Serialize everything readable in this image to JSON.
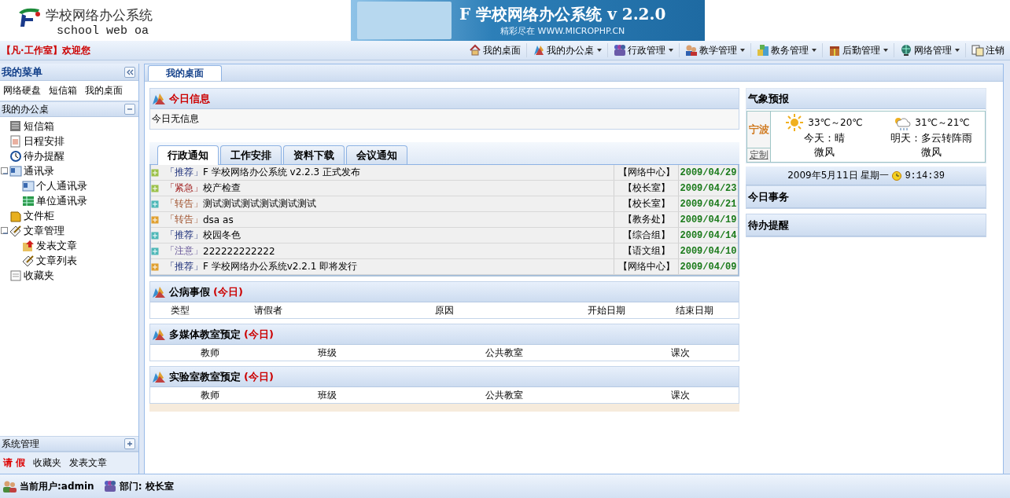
{
  "header": {
    "logo_title": "学校网络办公系统",
    "logo_subtitle": "school web oa",
    "banner": {
      "title": "F 学校网络办公系统 v 2.2.0",
      "subtitle": "精彩尽在 WWW.MICROPHP.CN"
    }
  },
  "welcome": "【凡·工作室】欢迎您",
  "nav": [
    {
      "label": "我的桌面",
      "has_menu": false
    },
    {
      "label": "我的办公桌",
      "has_menu": true
    },
    {
      "label": "行政管理",
      "has_menu": true
    },
    {
      "label": "教学管理",
      "has_menu": true
    },
    {
      "label": "教务管理",
      "has_menu": true
    },
    {
      "label": "后勤管理",
      "has_menu": true
    },
    {
      "label": "网络管理",
      "has_menu": true
    },
    {
      "label": "注销",
      "has_menu": false
    }
  ],
  "sidebar": {
    "title": "我的菜单",
    "quick_links": [
      "网络硬盘",
      "短信箱",
      "我的桌面"
    ],
    "desk": {
      "title": "我的办公桌",
      "expanded": true,
      "tree": [
        {
          "label": "短信箱"
        },
        {
          "label": "日程安排"
        },
        {
          "label": "待办提醒"
        },
        {
          "label": "通讯录",
          "expanded": true,
          "children": [
            {
              "label": "个人通讯录"
            },
            {
              "label": "单位通讯录"
            }
          ]
        },
        {
          "label": "文件柜"
        },
        {
          "label": "文章管理",
          "expanded": true,
          "children": [
            {
              "label": "发表文章"
            },
            {
              "label": "文章列表"
            }
          ]
        },
        {
          "label": "收藏夹"
        }
      ]
    },
    "system": {
      "title": "系统管理",
      "expanded": false
    },
    "bottom_links": [
      {
        "label": "请 假",
        "kind": "highlight"
      },
      {
        "label": "收藏夹",
        "kind": "plain"
      },
      {
        "label": "发表文章",
        "kind": "plain"
      }
    ]
  },
  "main_tabs": [
    {
      "label": "我的桌面",
      "selected": true
    }
  ],
  "today_info": {
    "title": "今日信息",
    "text": "今日无信息"
  },
  "notices": {
    "tabs": [
      {
        "label": "行政通知",
        "selected": true
      },
      {
        "label": "工作安排",
        "selected": false
      },
      {
        "label": "资料下载",
        "selected": false
      },
      {
        "label": "会议通知",
        "selected": false
      }
    ],
    "rows": [
      {
        "tag": "「推荐」",
        "kind": "recommend",
        "color": "#9cc14a",
        "title": "F 学校网络办公系统 v2.2.3 正式发布",
        "dept": "【网络中心】",
        "date": "2009/04/29"
      },
      {
        "tag": "「紧急」",
        "kind": "urgent",
        "color": "#9cc14a",
        "title": "校产检查",
        "dept": "【校长室】",
        "date": "2009/04/23"
      },
      {
        "tag": "「转告」",
        "kind": "relay",
        "color": "#4fb8b8",
        "title": "测试测试测试测试测试测试",
        "dept": "【校长室】",
        "date": "2009/04/21"
      },
      {
        "tag": "「转告」",
        "kind": "relay",
        "color": "#e0a030",
        "title": "dsa as",
        "dept": "【教务处】",
        "date": "2009/04/19"
      },
      {
        "tag": "「推荐」",
        "kind": "recommend",
        "color": "#4fb8b8",
        "title": "校园冬色",
        "dept": "【综合组】",
        "date": "2009/04/14"
      },
      {
        "tag": "「注意」",
        "kind": "notice",
        "color": "#4fb8b8",
        "title": "222222222222",
        "dept": "【语文组】",
        "date": "2009/04/10"
      },
      {
        "tag": "「推荐」",
        "kind": "recommend",
        "color": "#e0a030",
        "title": "F 学校网络办公系统v2.2.1 即将发行",
        "dept": "【网络中心】",
        "date": "2009/04/09"
      }
    ]
  },
  "bookings": [
    {
      "title": "公病事假",
      "note": "(今日)",
      "columns": [
        "类型",
        "请假者",
        "原因",
        "开始日期",
        "结束日期"
      ]
    },
    {
      "title": "多媒体教室预定",
      "note": "(今日)",
      "columns": [
        "教师",
        "班级",
        "公共教室",
        "课次"
      ]
    },
    {
      "title": "实验室教室预定",
      "note": "(今日)",
      "columns": [
        "教师",
        "班级",
        "公共教室",
        "课次"
      ]
    }
  ],
  "weather": {
    "title": "气象预报",
    "city": "宁波",
    "customize": "定制",
    "days": [
      {
        "kind": "sunny",
        "temp": "33℃～20℃",
        "label": "今天：晴",
        "wind": "微风"
      },
      {
        "kind": "showers",
        "temp": "31℃～21℃",
        "label": "明天：多云转阵雨",
        "wind": "微风"
      }
    ]
  },
  "datetime": {
    "date": "2009年5月11日 星期一",
    "time": "9:14:39"
  },
  "panels": [
    {
      "title": "今日事务"
    },
    {
      "title": "待办提醒"
    }
  ],
  "status": {
    "user": "当前用户:admin",
    "department": "部门: 校长室"
  }
}
